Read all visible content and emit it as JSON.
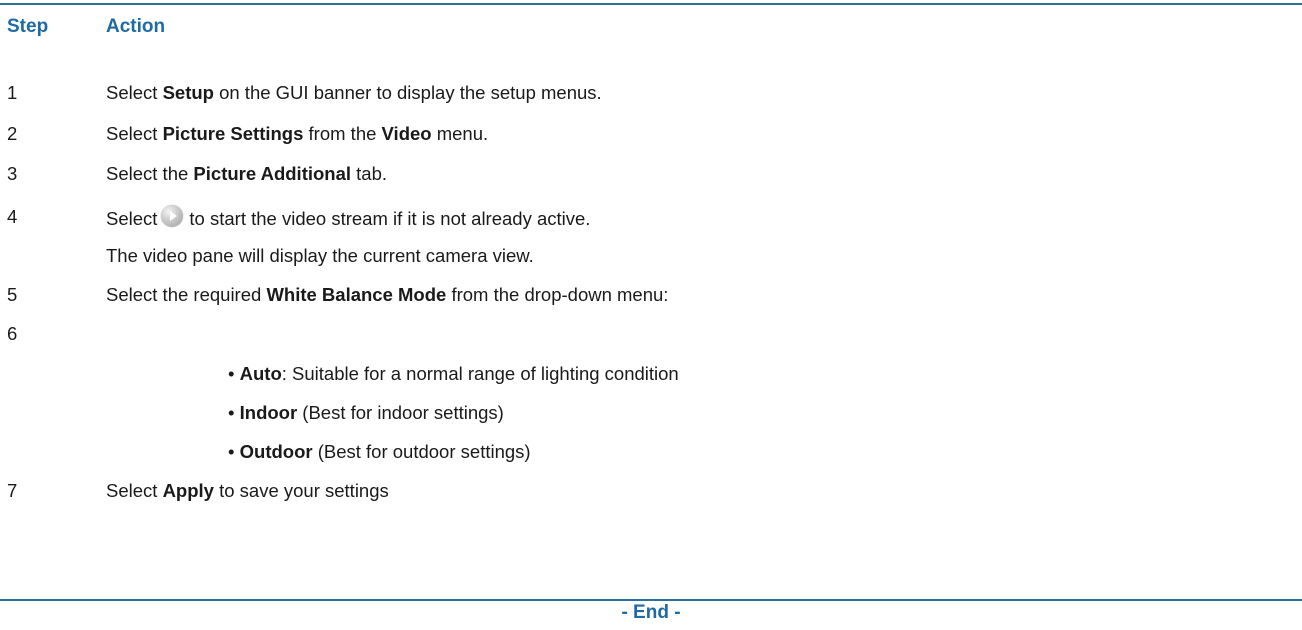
{
  "header": {
    "step": "Step",
    "action": "Action"
  },
  "steps": [
    {
      "num": "1",
      "pre": "Select ",
      "b1": "Setup",
      "post": " on the GUI banner to display the setup menus."
    },
    {
      "num": "2",
      "pre": "Select ",
      "b1": "Picture Settings",
      "mid": " from the ",
      "b2": "Video",
      "post": " menu."
    },
    {
      "num": "3",
      "pre": "Select the ",
      "b1": "Picture Additional",
      "post": " tab."
    },
    {
      "num": "4",
      "pre": "Select",
      "post": "to start the video stream if it is not already active.",
      "note": "The video pane will display the current camera view.",
      "icon": "play-icon"
    },
    {
      "num": "5",
      "pre": "Select the required ",
      "b1": "White Balance Mode",
      "post": " from the drop-down menu:"
    },
    {
      "num": "6"
    },
    {
      "num": "7",
      "pre": "Select ",
      "b1": "Apply",
      "post": " to save your settings"
    }
  ],
  "options": [
    {
      "bullet": "•",
      "b": "Auto",
      "text": ": Suitable for a normal range of lighting condition"
    },
    {
      "bullet": "•",
      "b": "Indoor",
      "text": " (Best for indoor settings)"
    },
    {
      "bullet": "•",
      "b": "Outdoor",
      "text": " (Best for outdoor settings)"
    }
  ],
  "footer": {
    "end": "- End -"
  },
  "colors": {
    "accent": "#1f6aa5",
    "rule": "#2b6f9e",
    "text": "#1a1a1a"
  }
}
